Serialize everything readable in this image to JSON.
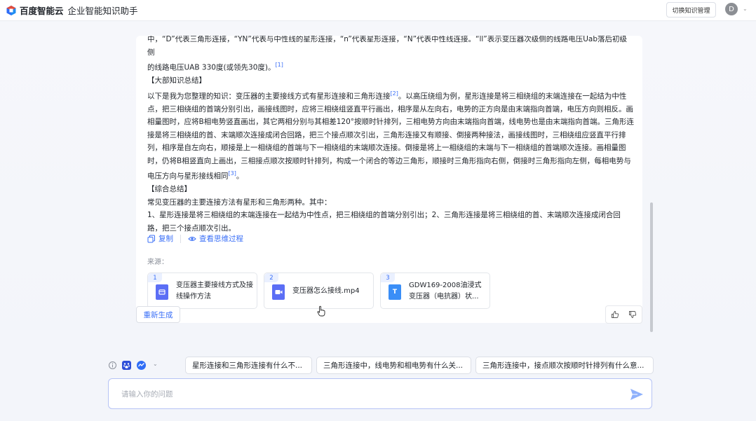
{
  "header": {
    "logo_text": "百度智能云",
    "app_title": "企业智能知识助手",
    "switch_button": "切换知识管理",
    "avatar_initial": "D"
  },
  "answer": {
    "line_top": "中，“D”代表三角形连接，“YN”代表与中性线的星形连接，“n”代表星形连接，“N”代表中性线连接。“ll”表示变压器次级侧的线路电压Uab落后初级侧",
    "para1": "的线路电压UAB 330度(或领先30度)。",
    "ref1": "[1]",
    "heading_external": "【大部知识总结】",
    "para2": "以下是我为您整理的知识：变压器的主要接线方式有星形连接和三角形连接",
    "ref2": "[2]",
    "para2_cont": "。以高压绕组为例，星形连接是将三相绕组的末端连接在一起结为中性点，把三相绕组的首端分别引出，画接线图时，应将三相绕组竖直平行画出，相序是从左向右，电势的正方向是由末端指向首端，电压方向则相反。画相量图时，应将B相电势竖直画出，其它两相分别与其相差120°按顺时针排列，三相电势方向由末端指向首端，线电势也是由末端指向首端。三角形连接是将三相绕组的首、末端顺次连接成闭合回路，把三个接点顺次引出，三角形连接又有顺接、倒接两种接法，画接线图时，三相绕组应竖直平行排列，相序是自左向右，顺接是上一相绕组的首端与下一相绕组的末端顺次连接。倒接是将上一相绕组的末端与下一相绕组的首端顺次连接。画相量图时，仍将B相竖直向上画出，三相接点顺次按顺时针排列，构成一个闭合的等边三角形，顺接时三角形指向右侧，倒接时三角形指向左侧，每相电势与电压方向与星形接线相同",
    "ref3": "[3]",
    "para2_end": "。",
    "heading_summary": "【综合总结】",
    "para3": "常见变压器的主要连接方法有星形和三角形两种。其中：",
    "para4": "1、星形连接是将三相绕组的末端连接在一起结为中性点，把三相绕组的首端分别引出；2、三角形连接是将三相绕组的首、末端顺次连接成闭合回路，把三个接点顺次引出。",
    "copy_label": "复制",
    "thinking_label": "查看思维过程",
    "source_label": "来源：",
    "sources": [
      {
        "num": "1",
        "title": "变压器主要接线方式及接线操作方法",
        "icon": "document-icon",
        "color": "#5b6ef5"
      },
      {
        "num": "2",
        "title": "变压器怎么接线.mp4",
        "icon": "video-icon",
        "color": "#5b6ef5"
      },
      {
        "num": "3",
        "title": "GDW169-2008油浸式变压器（电抗器）状...",
        "icon": "text-file-icon",
        "color": "#3a8ef7"
      }
    ]
  },
  "regenerate_label": "重新生成",
  "suggestions": [
    "星形连接和三角形连接有什么不...",
    "三角形连接中，线电势和相电势有什么关...",
    "三角形连接中，接点顺次按顺时针排列有什么意..."
  ],
  "input": {
    "placeholder": "请输入你的问题"
  },
  "colors": {
    "accent": "#3a6ff7",
    "border_focus": "#b6c3f5"
  }
}
